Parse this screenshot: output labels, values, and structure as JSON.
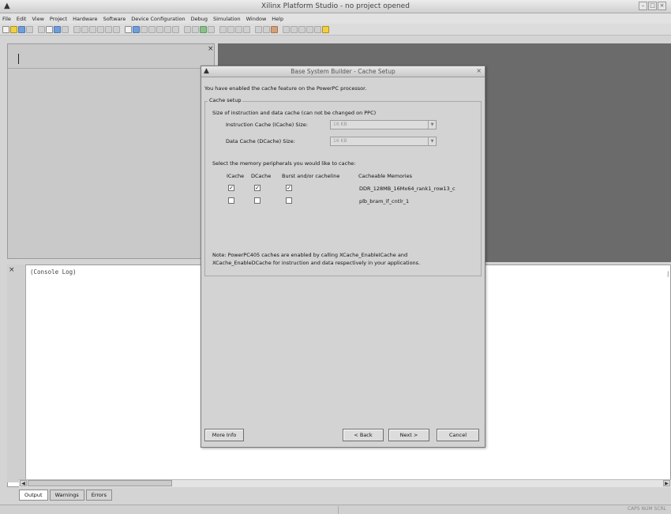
{
  "window": {
    "title": "Xilinx Platform Studio - no project opened",
    "min_glyph": "–",
    "max_glyph": "□",
    "close_glyph": "×"
  },
  "menu": [
    "File",
    "Edit",
    "View",
    "Project",
    "Hardware",
    "Software",
    "Device Configuration",
    "Debug",
    "Simulation",
    "Window",
    "Help"
  ],
  "console": {
    "log_label": "(Console Log)",
    "tabs": [
      "Output",
      "Warnings",
      "Errors"
    ]
  },
  "dialog": {
    "title": "Base System Builder - Cache Setup",
    "intro": "You have enabled the cache feature on the PowerPC processor.",
    "group_label": "Cache setup",
    "size_heading": "Size of instruction and data cache (can not be changed on PPC)",
    "icache_label": "Instruction Cache (ICache) Size:",
    "icache_value": "16 KB",
    "dcache_label": "Data Cache (DCache) Size:",
    "dcache_value": "16 KB",
    "peripherals_heading": "Select the memory peripherals you would like to cache:",
    "columns": [
      "ICache",
      "DCache",
      "Burst and/or cacheline",
      "Cacheable Memories"
    ],
    "rows": [
      {
        "icache": true,
        "dcache": true,
        "burst": true,
        "memory": "DDR_128MB_16Mx64_rank1_row13_c"
      },
      {
        "icache": false,
        "dcache": false,
        "burst": false,
        "memory": "plb_bram_if_cntlr_1"
      }
    ],
    "note_line1": "Note: PowerPC405 caches are enabled by calling XCache_EnableICache and",
    "note_line2": "XCache_EnableDCache for instruction and data respectively in your applications.",
    "buttons": {
      "more_info": "More Info",
      "back": "< Back",
      "next": "Next >",
      "cancel": "Cancel"
    }
  },
  "status_right": "CAPS NUM SCRL",
  "colors": {
    "workspace": "#6b6b6b",
    "dialog_bg": "#d3d3d3",
    "console_bg": "#ffffff"
  }
}
